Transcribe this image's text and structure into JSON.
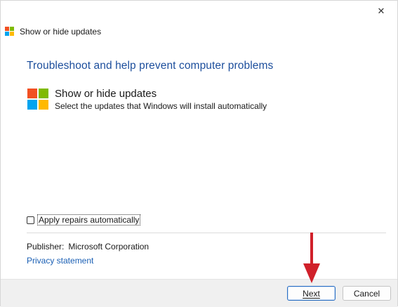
{
  "window": {
    "title": "Show or hide updates",
    "close_glyph": "✕"
  },
  "main": {
    "heading": "Troubleshoot and help prevent computer problems",
    "task": {
      "title": "Show or hide updates",
      "description": "Select the updates that Windows will install automatically",
      "icon": "windows-logo-icon"
    },
    "apply_repairs": {
      "label": "Apply repairs automatically",
      "checked": false
    },
    "publisher": {
      "label": "Publisher:",
      "value": "Microsoft Corporation"
    },
    "privacy_link": "Privacy statement"
  },
  "footer": {
    "next_label": "Next",
    "cancel_label": "Cancel"
  },
  "colors": {
    "heading": "#1c4e9c",
    "link": "#1a5fb4",
    "annotation_arrow": "#d0202a",
    "logo_red": "#f25022",
    "logo_green": "#7fba00",
    "logo_blue": "#00a4ef",
    "logo_yellow": "#ffb900"
  }
}
